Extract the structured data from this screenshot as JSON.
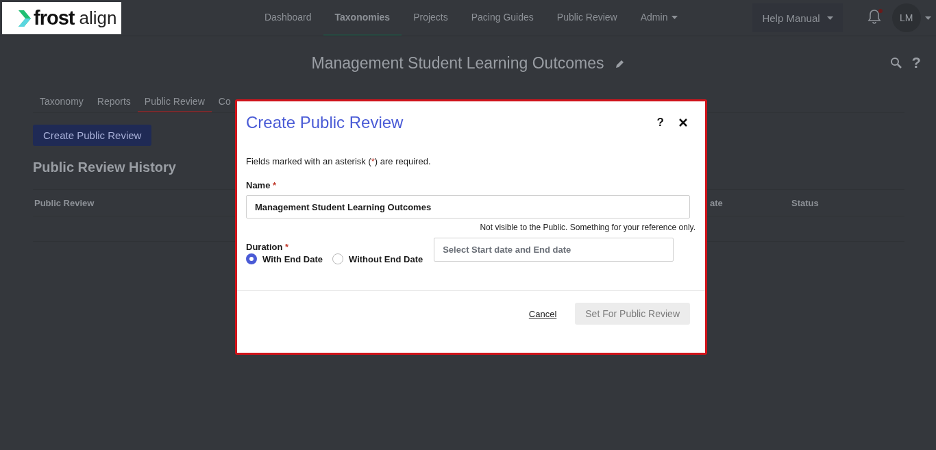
{
  "logo": {
    "brand": "frost",
    "product": "align"
  },
  "nav": [
    {
      "label": "Dashboard",
      "selected": false,
      "has_menu": false
    },
    {
      "label": "Taxonomies",
      "selected": true,
      "has_menu": false
    },
    {
      "label": "Projects",
      "selected": false,
      "has_menu": false
    },
    {
      "label": "Pacing Guides",
      "selected": false,
      "has_menu": false
    },
    {
      "label": "Public Review",
      "selected": false,
      "has_menu": false
    },
    {
      "label": "Admin",
      "selected": false,
      "has_menu": true
    }
  ],
  "help_menu": {
    "label": "Help Manual"
  },
  "notifications": {
    "unread": true
  },
  "user": {
    "initials": "LM"
  },
  "page_title": "Management Student Learning Outcomes",
  "page_help": "?",
  "tabs": [
    {
      "label": "Taxonomy",
      "selected": false
    },
    {
      "label": "Reports",
      "selected": false
    },
    {
      "label": "Public Review",
      "selected": true
    },
    {
      "label": "Co",
      "selected": false
    }
  ],
  "create_button": "Create Public Review",
  "history_heading": "Public Review History",
  "table": {
    "columns": [
      "Public Review",
      "ate",
      "Status"
    ]
  },
  "dialog": {
    "title": "Create Public Review",
    "help": "?",
    "intro": {
      "before": "Fields marked with an asterisk (",
      "mark": "*",
      "after": ") are required."
    },
    "name_field": {
      "label": "Name",
      "required": true,
      "value": "Management Student Learning Outcomes",
      "hint": "Not visible to the Public. Something for your reference only."
    },
    "duration": {
      "label": "Duration",
      "required": true,
      "options": [
        {
          "label": "With End Date",
          "selected": true
        },
        {
          "label": "Without End Date",
          "selected": false
        }
      ],
      "date_field": {
        "placeholder": "Select Start date and End date"
      }
    },
    "cancel": "Cancel",
    "submit": {
      "label": "Set For Public Review",
      "disabled": true
    }
  }
}
